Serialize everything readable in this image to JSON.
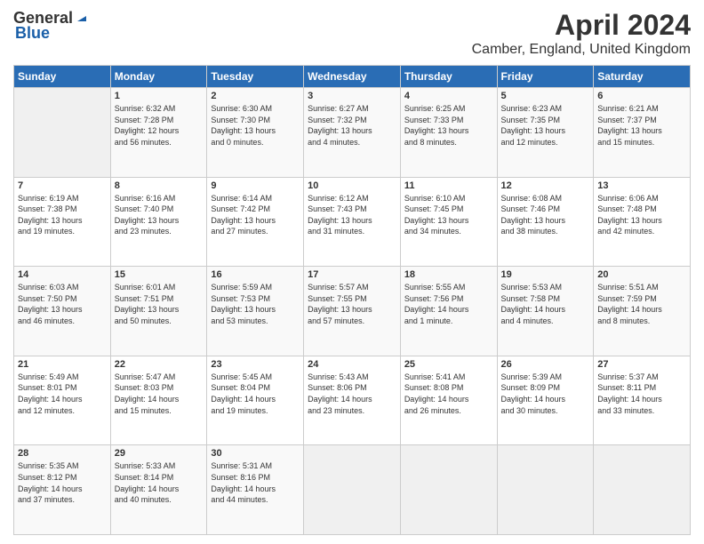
{
  "header": {
    "logo_general": "General",
    "logo_blue": "Blue",
    "title": "April 2024",
    "subtitle": "Camber, England, United Kingdom"
  },
  "calendar": {
    "days_header": [
      "Sunday",
      "Monday",
      "Tuesday",
      "Wednesday",
      "Thursday",
      "Friday",
      "Saturday"
    ],
    "weeks": [
      [
        {
          "day": "",
          "info": ""
        },
        {
          "day": "1",
          "info": "Sunrise: 6:32 AM\nSunset: 7:28 PM\nDaylight: 12 hours\nand 56 minutes."
        },
        {
          "day": "2",
          "info": "Sunrise: 6:30 AM\nSunset: 7:30 PM\nDaylight: 13 hours\nand 0 minutes."
        },
        {
          "day": "3",
          "info": "Sunrise: 6:27 AM\nSunset: 7:32 PM\nDaylight: 13 hours\nand 4 minutes."
        },
        {
          "day": "4",
          "info": "Sunrise: 6:25 AM\nSunset: 7:33 PM\nDaylight: 13 hours\nand 8 minutes."
        },
        {
          "day": "5",
          "info": "Sunrise: 6:23 AM\nSunset: 7:35 PM\nDaylight: 13 hours\nand 12 minutes."
        },
        {
          "day": "6",
          "info": "Sunrise: 6:21 AM\nSunset: 7:37 PM\nDaylight: 13 hours\nand 15 minutes."
        }
      ],
      [
        {
          "day": "7",
          "info": "Sunrise: 6:19 AM\nSunset: 7:38 PM\nDaylight: 13 hours\nand 19 minutes."
        },
        {
          "day": "8",
          "info": "Sunrise: 6:16 AM\nSunset: 7:40 PM\nDaylight: 13 hours\nand 23 minutes."
        },
        {
          "day": "9",
          "info": "Sunrise: 6:14 AM\nSunset: 7:42 PM\nDaylight: 13 hours\nand 27 minutes."
        },
        {
          "day": "10",
          "info": "Sunrise: 6:12 AM\nSunset: 7:43 PM\nDaylight: 13 hours\nand 31 minutes."
        },
        {
          "day": "11",
          "info": "Sunrise: 6:10 AM\nSunset: 7:45 PM\nDaylight: 13 hours\nand 34 minutes."
        },
        {
          "day": "12",
          "info": "Sunrise: 6:08 AM\nSunset: 7:46 PM\nDaylight: 13 hours\nand 38 minutes."
        },
        {
          "day": "13",
          "info": "Sunrise: 6:06 AM\nSunset: 7:48 PM\nDaylight: 13 hours\nand 42 minutes."
        }
      ],
      [
        {
          "day": "14",
          "info": "Sunrise: 6:03 AM\nSunset: 7:50 PM\nDaylight: 13 hours\nand 46 minutes."
        },
        {
          "day": "15",
          "info": "Sunrise: 6:01 AM\nSunset: 7:51 PM\nDaylight: 13 hours\nand 50 minutes."
        },
        {
          "day": "16",
          "info": "Sunrise: 5:59 AM\nSunset: 7:53 PM\nDaylight: 13 hours\nand 53 minutes."
        },
        {
          "day": "17",
          "info": "Sunrise: 5:57 AM\nSunset: 7:55 PM\nDaylight: 13 hours\nand 57 minutes."
        },
        {
          "day": "18",
          "info": "Sunrise: 5:55 AM\nSunset: 7:56 PM\nDaylight: 14 hours\nand 1 minute."
        },
        {
          "day": "19",
          "info": "Sunrise: 5:53 AM\nSunset: 7:58 PM\nDaylight: 14 hours\nand 4 minutes."
        },
        {
          "day": "20",
          "info": "Sunrise: 5:51 AM\nSunset: 7:59 PM\nDaylight: 14 hours\nand 8 minutes."
        }
      ],
      [
        {
          "day": "21",
          "info": "Sunrise: 5:49 AM\nSunset: 8:01 PM\nDaylight: 14 hours\nand 12 minutes."
        },
        {
          "day": "22",
          "info": "Sunrise: 5:47 AM\nSunset: 8:03 PM\nDaylight: 14 hours\nand 15 minutes."
        },
        {
          "day": "23",
          "info": "Sunrise: 5:45 AM\nSunset: 8:04 PM\nDaylight: 14 hours\nand 19 minutes."
        },
        {
          "day": "24",
          "info": "Sunrise: 5:43 AM\nSunset: 8:06 PM\nDaylight: 14 hours\nand 23 minutes."
        },
        {
          "day": "25",
          "info": "Sunrise: 5:41 AM\nSunset: 8:08 PM\nDaylight: 14 hours\nand 26 minutes."
        },
        {
          "day": "26",
          "info": "Sunrise: 5:39 AM\nSunset: 8:09 PM\nDaylight: 14 hours\nand 30 minutes."
        },
        {
          "day": "27",
          "info": "Sunrise: 5:37 AM\nSunset: 8:11 PM\nDaylight: 14 hours\nand 33 minutes."
        }
      ],
      [
        {
          "day": "28",
          "info": "Sunrise: 5:35 AM\nSunset: 8:12 PM\nDaylight: 14 hours\nand 37 minutes."
        },
        {
          "day": "29",
          "info": "Sunrise: 5:33 AM\nSunset: 8:14 PM\nDaylight: 14 hours\nand 40 minutes."
        },
        {
          "day": "30",
          "info": "Sunrise: 5:31 AM\nSunset: 8:16 PM\nDaylight: 14 hours\nand 44 minutes."
        },
        {
          "day": "",
          "info": ""
        },
        {
          "day": "",
          "info": ""
        },
        {
          "day": "",
          "info": ""
        },
        {
          "day": "",
          "info": ""
        }
      ]
    ]
  }
}
